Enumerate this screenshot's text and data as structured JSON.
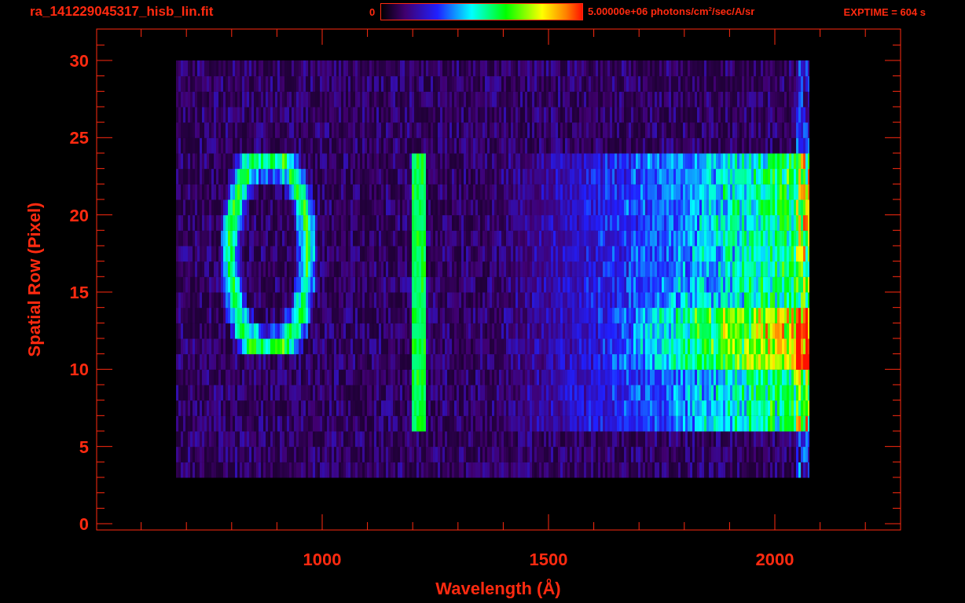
{
  "header": {
    "title": "ra_141229045317_hisb_lin.fit",
    "colorbar": {
      "min_label": "0",
      "max_label": "5.00000e+06 photons/cm$^{2}$/sec/A/sr"
    },
    "exposure": "EXPTIME = 604 s"
  },
  "plot": {
    "xlabel": "Wavelength (Å)",
    "ylabel": "Spatial Row (Pixel)",
    "xticks": [
      "1000",
      "1500",
      "2000"
    ],
    "yticks": [
      "30",
      "25",
      "20",
      "15",
      "10",
      "5",
      "0"
    ]
  }
}
